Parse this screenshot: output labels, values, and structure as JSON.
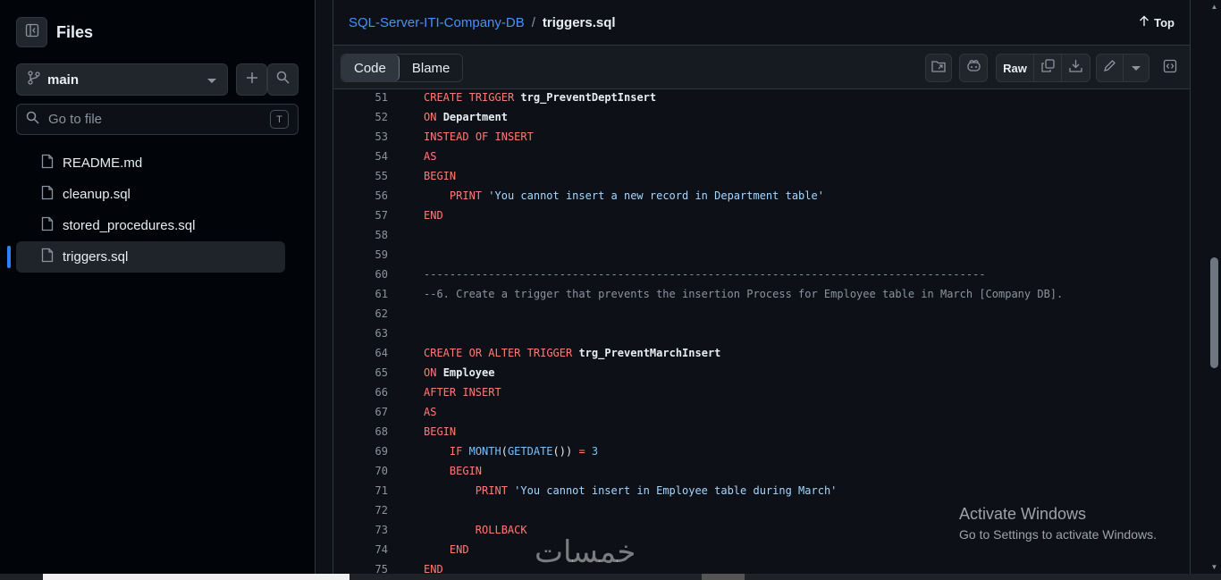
{
  "sidebar": {
    "title": "Files",
    "branch": "main",
    "search_placeholder": "Go to file",
    "search_shortcut": "T",
    "files": [
      {
        "name": "README.md",
        "active": false
      },
      {
        "name": "cleanup.sql",
        "active": false
      },
      {
        "name": "stored_procedures.sql",
        "active": false
      },
      {
        "name": "triggers.sql",
        "active": true
      }
    ]
  },
  "header": {
    "repo": "SQL-Server-ITI-Company-DB",
    "separator": "/",
    "file": "triggers.sql",
    "top_label": "Top"
  },
  "toolbar": {
    "code_tab": "Code",
    "blame_tab": "Blame",
    "raw_label": "Raw"
  },
  "code": {
    "lines": [
      {
        "n": "51",
        "text": "CREATE TRIGGER trg_PreventDeptInsert"
      },
      {
        "n": "52",
        "text": "ON Department"
      },
      {
        "n": "53",
        "text": "INSTEAD OF INSERT"
      },
      {
        "n": "54",
        "text": "AS"
      },
      {
        "n": "55",
        "text": "BEGIN"
      },
      {
        "n": "56",
        "text": "    PRINT 'You cannot insert a new record in Department table'"
      },
      {
        "n": "57",
        "text": "END"
      },
      {
        "n": "58",
        "text": ""
      },
      {
        "n": "59",
        "text": ""
      },
      {
        "n": "60",
        "text": "---------------------------------------------------------------------------------------"
      },
      {
        "n": "61",
        "text": "--6. Create a trigger that prevents the insertion Process for Employee table in March [Company DB]."
      },
      {
        "n": "62",
        "text": ""
      },
      {
        "n": "63",
        "text": ""
      },
      {
        "n": "64",
        "text": "CREATE OR ALTER TRIGGER trg_PreventMarchInsert"
      },
      {
        "n": "65",
        "text": "ON Employee"
      },
      {
        "n": "66",
        "text": "AFTER INSERT"
      },
      {
        "n": "67",
        "text": "AS"
      },
      {
        "n": "68",
        "text": "BEGIN"
      },
      {
        "n": "69",
        "text": "    IF MONTH(GETDATE()) = 3"
      },
      {
        "n": "70",
        "text": "    BEGIN"
      },
      {
        "n": "71",
        "text": "        PRINT 'You cannot insert in Employee table during March'"
      },
      {
        "n": "72",
        "text": ""
      },
      {
        "n": "73",
        "text": "        ROLLBACK"
      },
      {
        "n": "74",
        "text": "    END"
      },
      {
        "n": "75",
        "text": "END"
      }
    ]
  },
  "overlay": {
    "activate_title": "Activate Windows",
    "activate_sub": "Go to Settings to activate Windows.",
    "watermark": "خمسات"
  },
  "colors": {
    "link": "#4493f8",
    "keyword": "#ff7b72",
    "string": "#a5d6ff",
    "builtin": "#79c0ff",
    "comment": "#8b949e"
  },
  "icons": [
    "sidebar-collapse-icon",
    "branch-icon",
    "chevron-down-icon",
    "plus-icon",
    "search-icon",
    "file-icon",
    "arrow-up-icon",
    "folder-icon",
    "copilot-icon",
    "copy-icon",
    "download-icon",
    "pencil-icon",
    "symbols-icon"
  ]
}
